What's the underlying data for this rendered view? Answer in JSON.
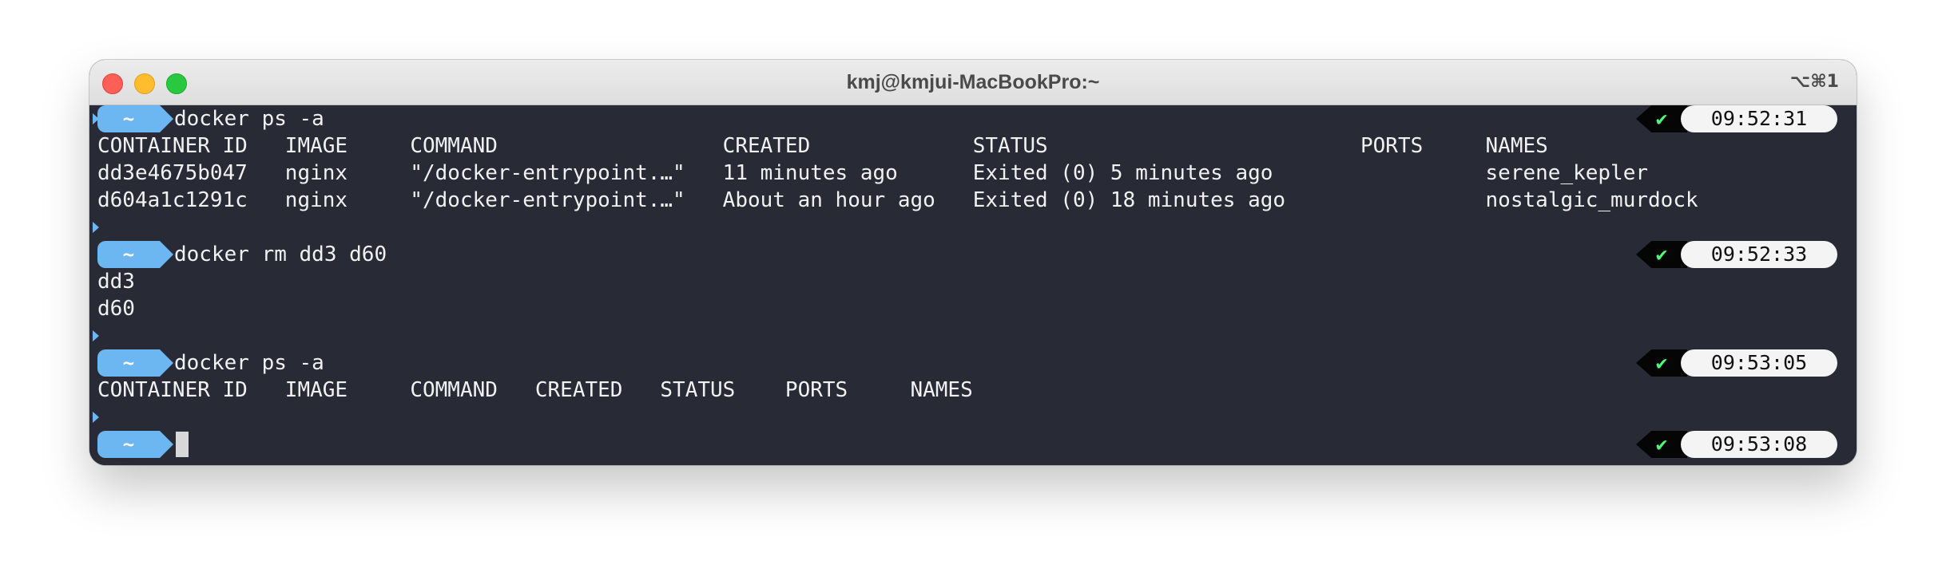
{
  "window": {
    "title": "kmj@kmjui-MacBookPro:~",
    "shortcut": "⌥⌘1"
  },
  "prompt_symbol": "~",
  "status_ok": "✔",
  "blocks": [
    {
      "command": "docker ps -a",
      "time": "09:52:31",
      "output": [
        "CONTAINER ID   IMAGE     COMMAND                  CREATED             STATUS                         PORTS     NAMES",
        "dd3e4675b047   nginx     \"/docker-entrypoint.…\"   11 minutes ago      Exited (0) 5 minutes ago                 serene_kepler",
        "d604a1c1291c   nginx     \"/docker-entrypoint.…\"   About an hour ago   Exited (0) 18 minutes ago                nostalgic_murdock"
      ]
    },
    {
      "command": "docker rm dd3 d60",
      "time": "09:52:33",
      "output": [
        "dd3",
        "d60"
      ]
    },
    {
      "command": "docker ps -a",
      "time": "09:53:05",
      "output": [
        "CONTAINER ID   IMAGE     COMMAND   CREATED   STATUS    PORTS     NAMES"
      ]
    },
    {
      "command": "",
      "time": "09:53:08",
      "output": []
    }
  ]
}
